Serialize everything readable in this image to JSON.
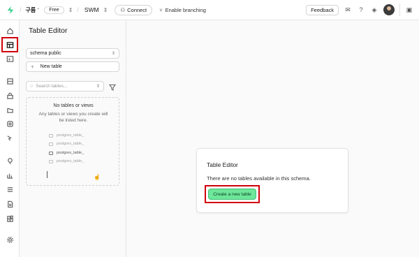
{
  "topbar": {
    "org_name": "구름",
    "plan_badge": "Free",
    "project_name": "SWM",
    "connect_label": "Connect",
    "branching_label": "Enable branching",
    "feedback_label": "Feedback"
  },
  "sidebar": {
    "title": "Table Editor",
    "schema_select": "schema public",
    "new_table_label": "New table",
    "search_placeholder": "Search tables...",
    "empty_title": "No tables or views",
    "empty_desc": "Any tables or views you create will be listed here.",
    "ghost_items": [
      "postgres_table_",
      "postgres_table_",
      "postgres_table_",
      "postgres_table_"
    ]
  },
  "main": {
    "card_title": "Table Editor",
    "card_desc": "There are no tables available in this schema.",
    "create_label": "Create a new table"
  },
  "colors": {
    "accent_green": "#6ee79b",
    "highlight_red": "#d0000a"
  }
}
